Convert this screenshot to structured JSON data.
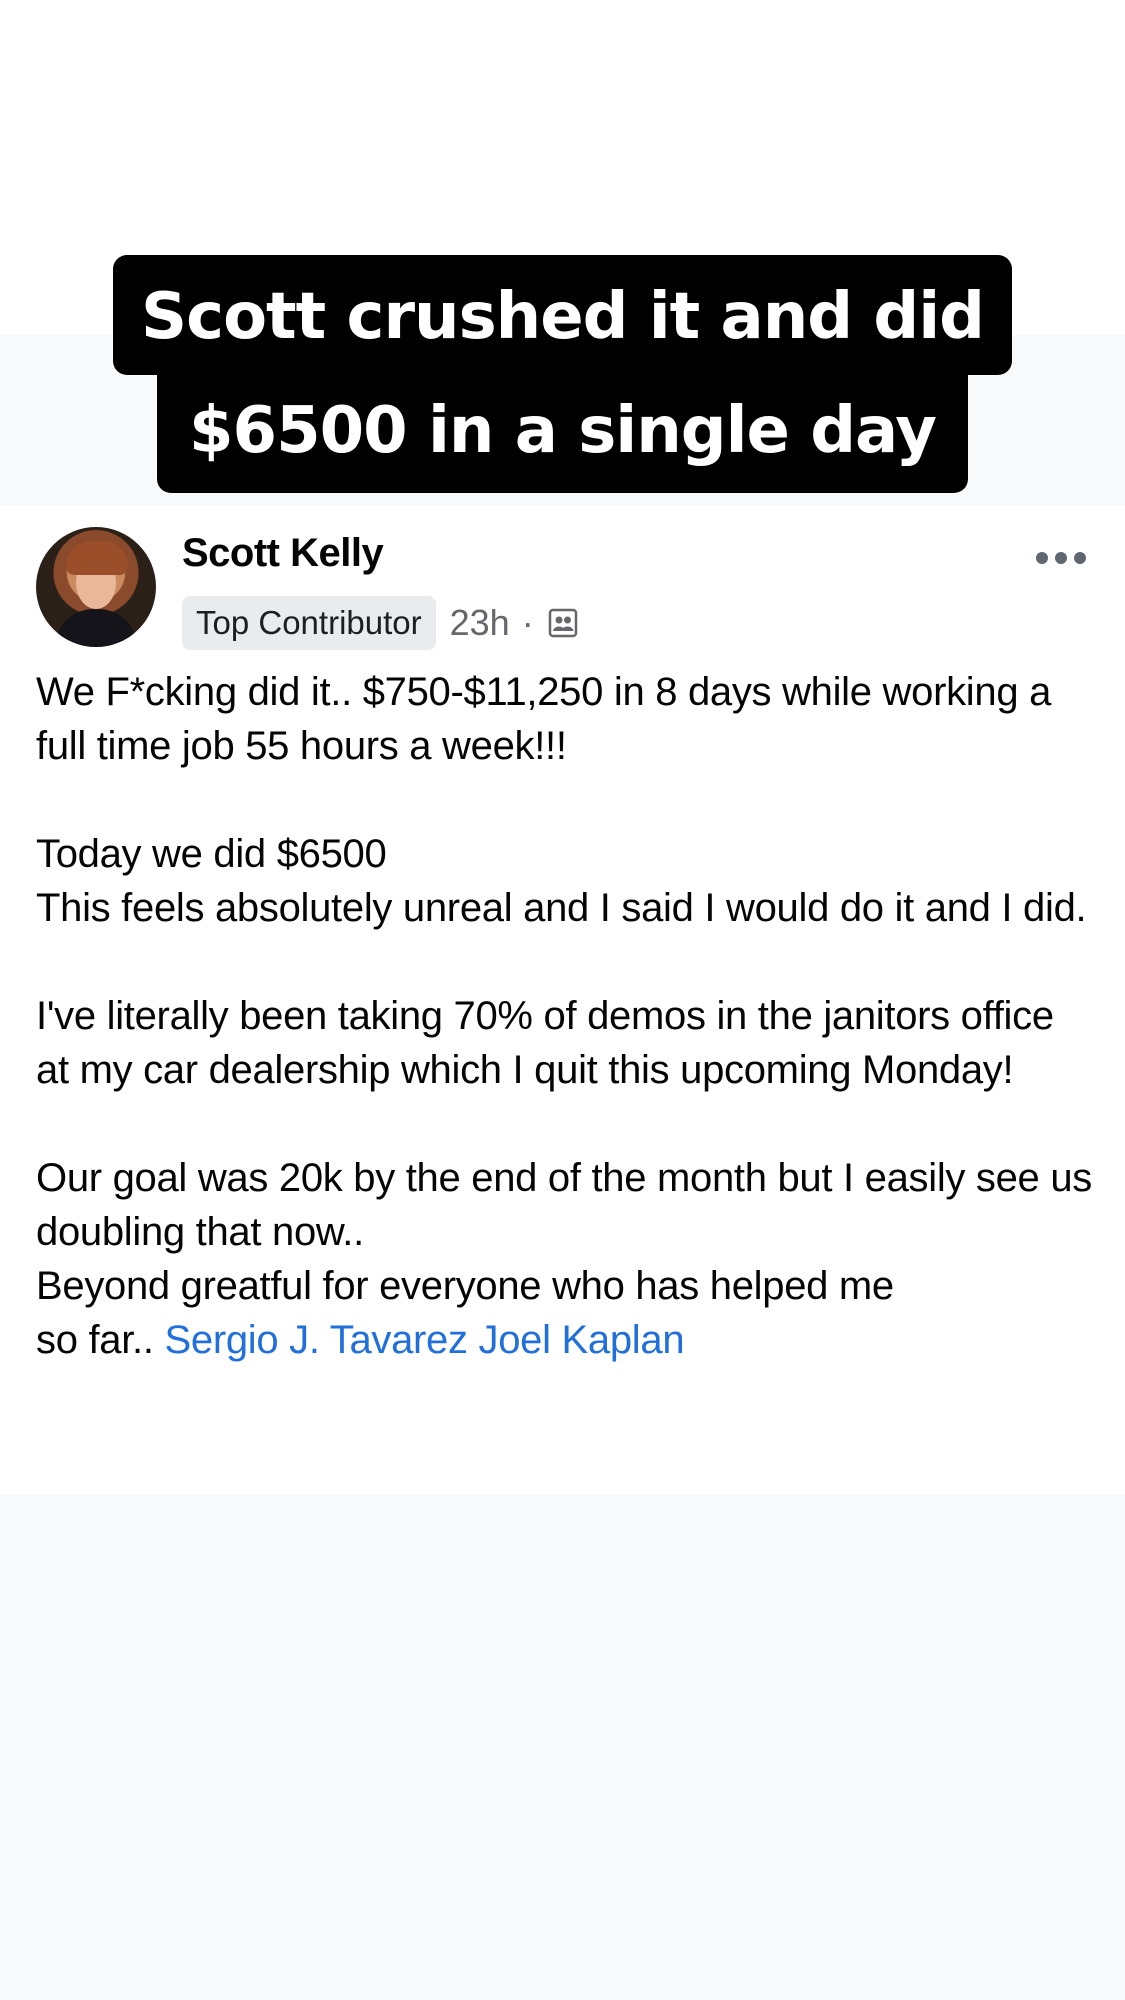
{
  "banner": {
    "line1": "Scott crushed it and did",
    "line2": "$6500 in a single day"
  },
  "post": {
    "author_name": "Scott Kelly",
    "badge": "Top Contributor",
    "timestamp": "23h",
    "separator": "·",
    "audience_icon": "group-members-icon",
    "more_icon": "more-options-icon",
    "paragraphs": [
      [
        "We F*cking did it.. $750-$11,250 in 8 days while working a full time job 55 hours a week!!!"
      ],
      [
        "Today we did $6500",
        "This feels absolutely unreal and I said I would do it and I did."
      ],
      [
        "I've literally been taking 70% of demos in the janitors office at my car dealership which I quit this upcoming Monday!"
      ],
      [
        "Our goal was 20k by the end of the month but I easily see us doubling that now..",
        "Beyond greatful for everyone who has helped me"
      ]
    ],
    "last_line_prefix": "so far..",
    "mentions": [
      "Sergio J. Tavarez",
      "Joel Kaplan"
    ]
  },
  "colors": {
    "mention": "#216fdb",
    "banner_bg": "#000000",
    "banner_text": "#ffffff",
    "secondary_text": "#65676b"
  }
}
